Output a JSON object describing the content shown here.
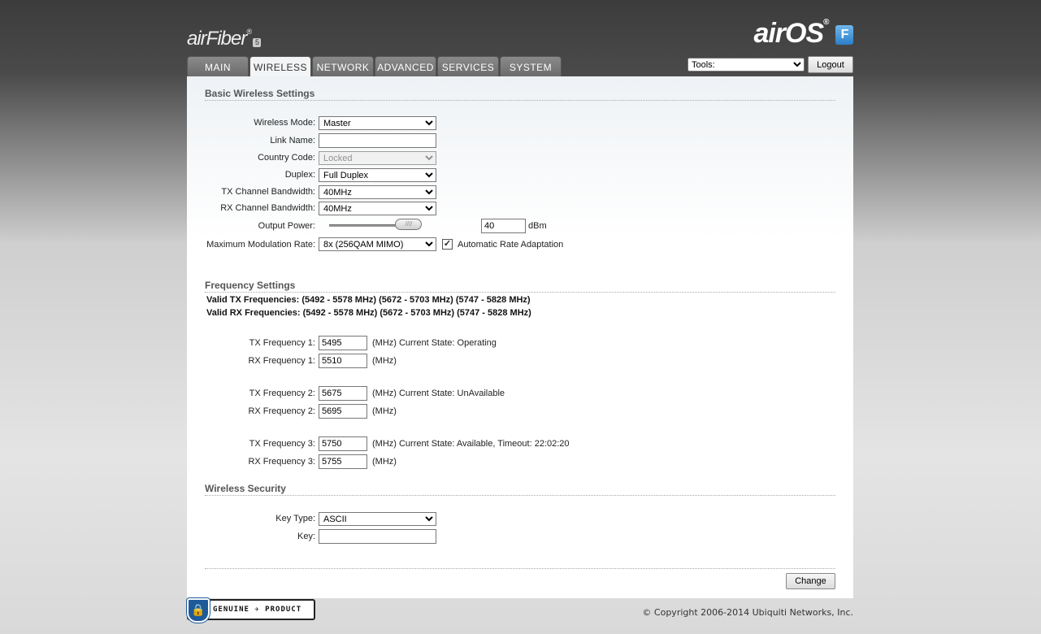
{
  "header": {
    "product_logo": "airFiber",
    "product_logo_sup": "®",
    "product_logo_badge": "5",
    "os_logo": "airOS",
    "os_logo_sup": "®",
    "os_badge": "F",
    "tabs": [
      {
        "label": "MAIN",
        "active": false
      },
      {
        "label": "WIRELESS",
        "active": true
      },
      {
        "label": "NETWORK",
        "active": false
      },
      {
        "label": "ADVANCED",
        "active": false
      },
      {
        "label": "SERVICES",
        "active": false
      },
      {
        "label": "SYSTEM",
        "active": false
      }
    ],
    "tools_selected": "Tools:",
    "logout_label": "Logout"
  },
  "basic": {
    "title": "Basic Wireless Settings",
    "wireless_mode_label": "Wireless Mode:",
    "wireless_mode_value": "Master",
    "link_name_label": "Link Name:",
    "link_name_value": "",
    "country_code_label": "Country Code:",
    "country_code_value": "Locked",
    "duplex_label": "Duplex:",
    "duplex_value": "Full Duplex",
    "tx_bw_label": "TX Channel Bandwidth:",
    "tx_bw_value": "40MHz",
    "rx_bw_label": "RX Channel Bandwidth:",
    "rx_bw_value": "40MHz",
    "output_power_label": "Output Power:",
    "output_power_value": "40",
    "output_power_unit": "dBm",
    "output_power_slider_fraction": 0.85,
    "mod_rate_label": "Maximum Modulation Rate:",
    "mod_rate_value": "8x (256QAM MIMO)",
    "auto_rate_label": "Automatic Rate Adaptation",
    "auto_rate_checked": true
  },
  "frequency": {
    "title": "Frequency Settings",
    "valid_tx": "Valid TX Frequencies: (5492 - 5578 MHz) (5672 - 5703 MHz) (5747 - 5828 MHz)",
    "valid_rx": "Valid RX Frequencies: (5492 - 5578 MHz) (5672 - 5703 MHz) (5747 - 5828 MHz)",
    "pairs": [
      {
        "tx_label": "TX Frequency 1:",
        "tx_value": "5495",
        "tx_note": "(MHz) Current State: Operating",
        "rx_label": "RX Frequency 1:",
        "rx_value": "5510",
        "rx_note": "(MHz)"
      },
      {
        "tx_label": "TX Frequency 2:",
        "tx_value": "5675",
        "tx_note": "(MHz) Current State: UnAvailable",
        "rx_label": "RX Frequency 2:",
        "rx_value": "5695",
        "rx_note": "(MHz)"
      },
      {
        "tx_label": "TX Frequency 3:",
        "tx_value": "5750",
        "tx_note": "(MHz) Current State: Available, Timeout: 22:02:20",
        "rx_label": "RX Frequency 3:",
        "rx_value": "5755",
        "rx_note": "(MHz)"
      }
    ]
  },
  "security": {
    "title": "Wireless Security",
    "key_type_label": "Key Type:",
    "key_type_value": "ASCII",
    "key_label": "Key:",
    "key_value": ""
  },
  "actions": {
    "change_label": "Change"
  },
  "footer": {
    "genuine_text": "GENUINE ✈ PRODUCT",
    "copyright": "© Copyright 2006-2014 Ubiquiti Networks, Inc."
  }
}
